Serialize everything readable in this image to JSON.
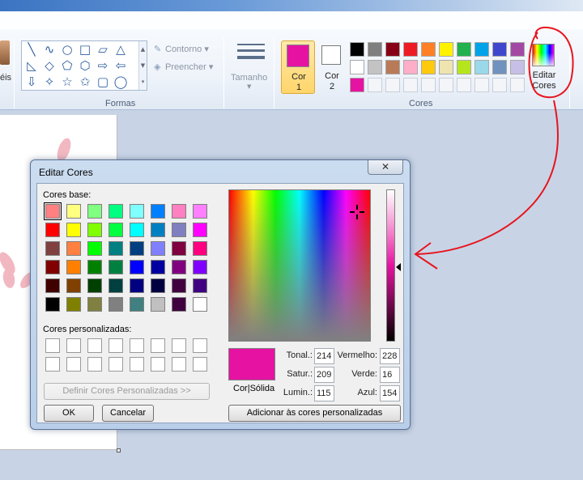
{
  "ribbon": {
    "brushes_label_fragment": "éis",
    "shapes": {
      "group_label": "Formas",
      "contour_label": "Contorno",
      "fill_label": "Preencher",
      "rows": [
        [
          "╲",
          "∿",
          "○",
          "□",
          "▱",
          "△"
        ],
        [
          "◺",
          "◇",
          "⬠",
          "⬡",
          "⇨",
          "⇦"
        ],
        [
          "⇩",
          "✧",
          "☆",
          "✩",
          "▢",
          "◯"
        ]
      ]
    },
    "size": {
      "label": "Tamanho"
    },
    "colors": {
      "group_label": "Cores",
      "color1_label": [
        "Cor",
        "1"
      ],
      "color2_label": [
        "Cor",
        "2"
      ],
      "color1_value": "#e613a2",
      "color2_value": "#ffffff",
      "edit_label": [
        "Editar",
        "Cores"
      ],
      "palette": [
        [
          "#000000",
          "#7f7f7f",
          "#880015",
          "#ed1c24",
          "#ff7f27",
          "#fff200",
          "#22b14c",
          "#00a2e8",
          "#3f48cc",
          "#a349a4"
        ],
        [
          "#ffffff",
          "#c3c3c3",
          "#b97a57",
          "#ffaec9",
          "#ffc90e",
          "#efe4b0",
          "#b5e61d",
          "#99d9ea",
          "#7092be",
          "#c8bfe7"
        ],
        [
          "#e613a2",
          "",
          "",
          "",
          "",
          "",
          "",
          "",
          "",
          ""
        ]
      ]
    }
  },
  "dialog": {
    "title": "Editar Cores",
    "close_label": "✕",
    "basic_colors_label": "Cores base:",
    "basic_colors": [
      [
        "#ff8080",
        "#ffff80",
        "#80ff80",
        "#00ff80",
        "#80ffff",
        "#0080ff",
        "#ff80c0",
        "#ff80ff"
      ],
      [
        "#ff0000",
        "#ffff00",
        "#80ff00",
        "#00ff40",
        "#00ffff",
        "#0080c0",
        "#8080c0",
        "#ff00ff"
      ],
      [
        "#804040",
        "#ff8040",
        "#00ff00",
        "#008080",
        "#004080",
        "#8080ff",
        "#800040",
        "#ff0080"
      ],
      [
        "#800000",
        "#ff8000",
        "#008000",
        "#008040",
        "#0000ff",
        "#0000a0",
        "#800080",
        "#8000ff"
      ],
      [
        "#400000",
        "#804000",
        "#004000",
        "#004040",
        "#000080",
        "#000040",
        "#400040",
        "#400080"
      ],
      [
        "#000000",
        "#808000",
        "#808040",
        "#808080",
        "#408080",
        "#c0c0c0",
        "#400040",
        "#ffffff"
      ]
    ],
    "custom_colors_label": "Cores personalizadas:",
    "define_custom_button": "Definir Cores Personalizadas >>",
    "ok_button": "OK",
    "cancel_button": "Cancelar",
    "add_custom_button": "Adicionar às cores personalizadas",
    "solid_label": "Cor|Sólida",
    "current_color": "#e613a2",
    "fields": {
      "hue_label": "Tonal.:",
      "hue": "214",
      "sat_label": "Satur.:",
      "sat": "209",
      "lum_label": "Lumin.:",
      "lum": "115",
      "red_label": "Vermelho:",
      "red": "228",
      "green_label": "Verde:",
      "green": "16",
      "blue_label": "Azul:",
      "blue": "154"
    }
  },
  "annotation_color": "#e8141e"
}
